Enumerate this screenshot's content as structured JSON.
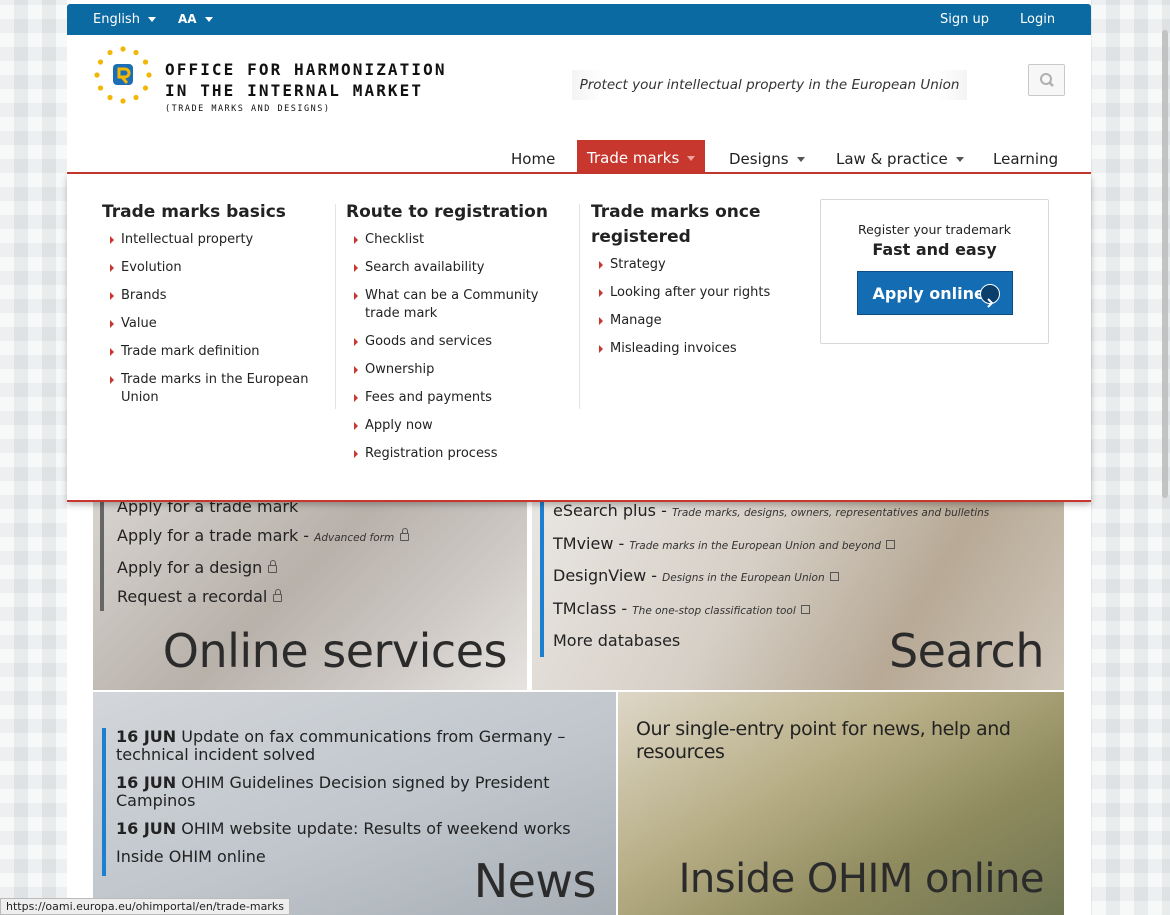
{
  "topbar": {
    "language": "English",
    "font_size": "AA",
    "signup": "Sign up",
    "login": "Login"
  },
  "header": {
    "logo_line1": "OFFICE FOR HARMONIZATION",
    "logo_line2": "IN THE INTERNAL MARKET",
    "logo_line3": "(TRADE MARKS AND DESIGNS)",
    "tagline": "Protect your intellectual property in the European Union"
  },
  "nav": {
    "home": "Home",
    "trade_marks": "Trade marks",
    "designs": "Designs",
    "law": "Law & practice",
    "learning": "Learning"
  },
  "mega": {
    "col1": {
      "title": "Trade marks basics",
      "items": [
        "Intellectual property",
        "Evolution",
        "Brands",
        "Value",
        "Trade mark definition",
        "Trade marks in the European Union"
      ]
    },
    "col2": {
      "title": "Route to registration",
      "items": [
        "Checklist",
        "Search availability",
        "What can be a Community trade mark",
        "Goods and services",
        "Ownership",
        "Fees and payments",
        "Apply now",
        "Registration process"
      ]
    },
    "col3": {
      "title": "Trade marks once registered",
      "items": [
        "Strategy",
        "Looking after your rights",
        "Manage",
        "Misleading invoices"
      ]
    },
    "promo": {
      "line1": "Register your trademark",
      "line2": "Fast and easy",
      "button": "Apply online"
    }
  },
  "online": {
    "title": "Online services",
    "items": [
      {
        "label": "Apply for a trade mark",
        "note": ""
      },
      {
        "label": "Apply for a trade mark",
        "note": "Advanced form"
      },
      {
        "label": "Apply for a design",
        "note": ""
      },
      {
        "label": "Request a recordal",
        "note": ""
      }
    ]
  },
  "search": {
    "title": "Search",
    "items": [
      {
        "label": "eSearch plus",
        "note": "Trade marks, designs, owners, representatives and bulletins"
      },
      {
        "label": "TMview",
        "note": "Trade marks in the European Union and beyond"
      },
      {
        "label": "DesignView",
        "note": "Designs in the European Union"
      },
      {
        "label": "TMclass",
        "note": "The one-stop classification tool"
      },
      {
        "label": "More databases",
        "note": ""
      }
    ],
    "separator": " - "
  },
  "news": {
    "title": "News",
    "items": [
      {
        "date": "16 JUN",
        "text": "Update on fax communications from Germany – technical incident solved"
      },
      {
        "date": "16 JUN",
        "text": "OHIM Guidelines Decision signed by President Campinos"
      },
      {
        "date": "16 JUN",
        "text": "OHIM website update: Results of weekend works"
      }
    ],
    "more": "Inside OHIM online"
  },
  "inside": {
    "title": "Inside OHIM online",
    "text": "Our single-entry point for news, help and resources"
  },
  "statusbar": {
    "url": "https://oami.europa.eu/ohimportal/en/trade-marks"
  },
  "colors": {
    "topbar": "#0a6aa1",
    "accent_red": "#c8372d",
    "button_blue": "#146cb2",
    "list_blue": "#1c7fd0"
  }
}
